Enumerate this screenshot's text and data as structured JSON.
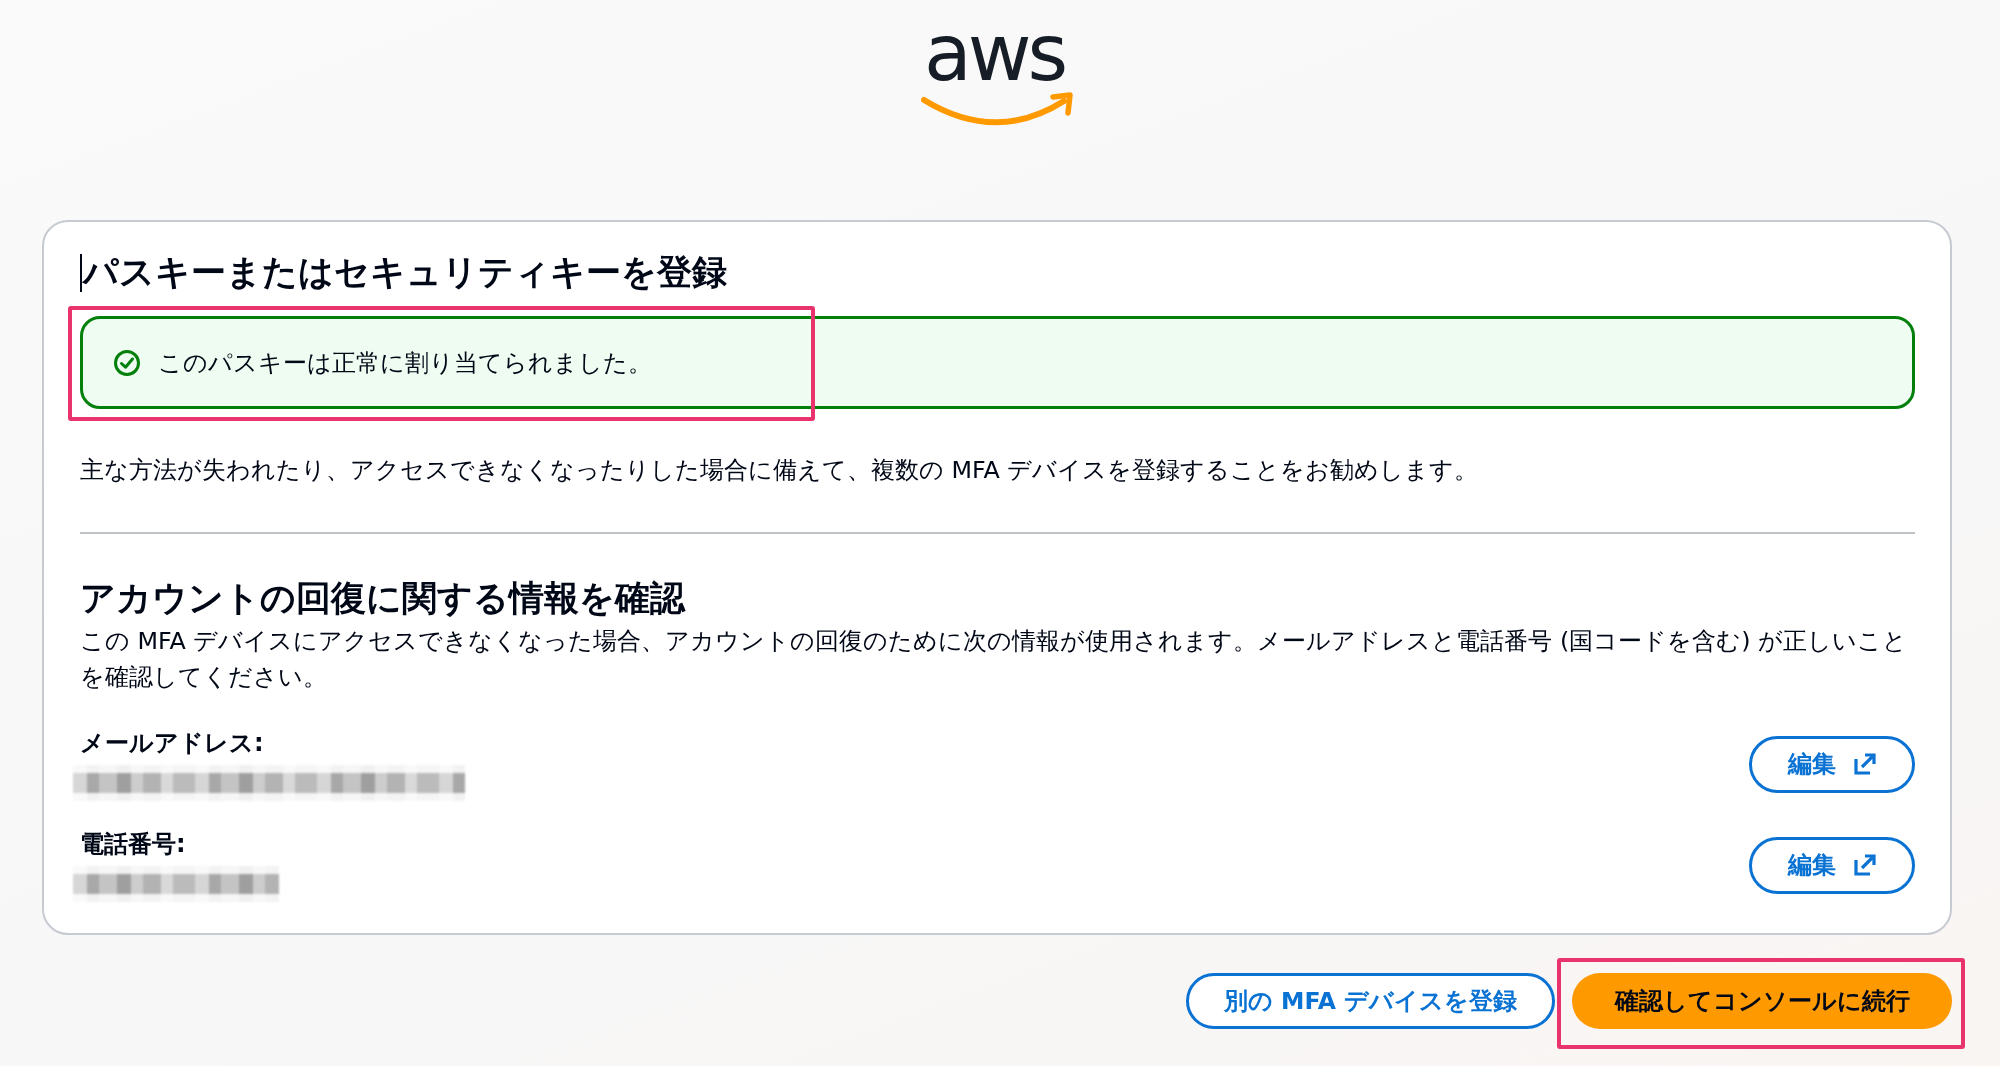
{
  "logo": {
    "text": "aws"
  },
  "card": {
    "title": {
      "text": "パスキーまたはセキュリティキーを登録",
      "caret": true
    },
    "alert": {
      "kind": "success",
      "message": "このパスキーは正常に割り当てられました。",
      "highlighted": true
    },
    "recommendation": "主な方法が失われたり、アクセスできなくなったりした場合に備えて、複数の MFA デバイスを登録することをお勧めします。",
    "recovery": {
      "heading": "アカウントの回復に関する情報を確認",
      "description": "この MFA デバイスにアクセスできなくなった場合、アカウントの回復のために次の情報が使用されます。メールアドレスと電話番号 (国コードを含む) が正しいことを確認してください。",
      "fields": [
        {
          "kind": "email",
          "label": "メールアドレス:",
          "redacted": true,
          "edit_button": "編集"
        },
        {
          "kind": "phone",
          "label": "電話番号:",
          "redacted": true,
          "edit_button": "編集"
        }
      ]
    }
  },
  "actions": [
    {
      "kind": "secondary",
      "label": "別の MFA デバイスを登録",
      "highlighted": false
    },
    {
      "kind": "primary",
      "label": "確認してコンソールに続行",
      "highlighted": true
    }
  ]
}
